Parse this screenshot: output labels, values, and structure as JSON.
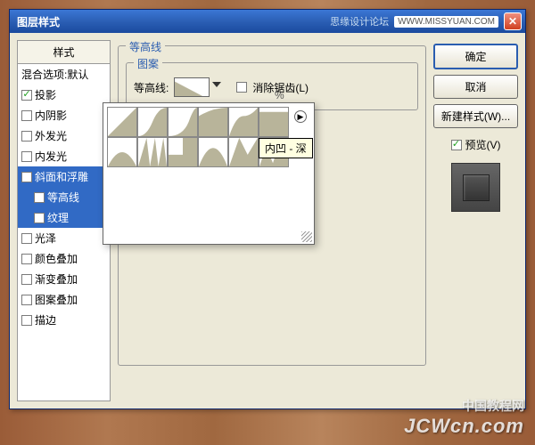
{
  "titlebar": {
    "title": "图层样式",
    "brand": "思缘设计论坛",
    "brandurl": "WWW.MISSYUAN.COM"
  },
  "left": {
    "header": "样式",
    "blend": "混合选项:默认",
    "items": [
      {
        "label": "投影",
        "checked": true,
        "sel": false
      },
      {
        "label": "内阴影",
        "checked": false,
        "sel": false
      },
      {
        "label": "外发光",
        "checked": false,
        "sel": false
      },
      {
        "label": "内发光",
        "checked": false,
        "sel": false
      },
      {
        "label": "斜面和浮雕",
        "checked": true,
        "sel": true
      },
      {
        "label": "等高线",
        "checked": true,
        "sel": true,
        "indent": true
      },
      {
        "label": "纹理",
        "checked": false,
        "sel": true,
        "indent": true
      },
      {
        "label": "光泽",
        "checked": false,
        "sel": false
      },
      {
        "label": "颜色叠加",
        "checked": false,
        "sel": false
      },
      {
        "label": "渐变叠加",
        "checked": false,
        "sel": false
      },
      {
        "label": "图案叠加",
        "checked": false,
        "sel": false
      },
      {
        "label": "描边",
        "checked": false,
        "sel": false
      }
    ]
  },
  "center": {
    "group": "等高线",
    "subgroup": "图案",
    "contour_label": "等高线:",
    "antialias": "消除锯齿(L)",
    "range_pct": "%"
  },
  "right": {
    "ok": "确定",
    "cancel": "取消",
    "newstyle": "新建样式(W)...",
    "preview": "预览(V)"
  },
  "tooltip": "内凹 - 深",
  "watermark": "JCWcn.com",
  "watermark2": "中国教程网"
}
